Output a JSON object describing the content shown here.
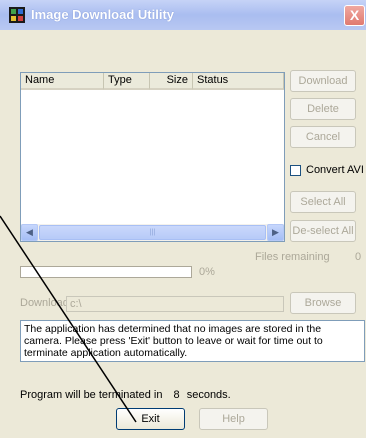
{
  "window": {
    "title": "Image Download Utility",
    "close_glyph": "X"
  },
  "list": {
    "columns": [
      "Name",
      "Type",
      "Size",
      "Status"
    ],
    "rows": [],
    "scroll_thumb_glyph": "|||"
  },
  "buttons": {
    "download": "Download",
    "delete": "Delete",
    "cancel": "Cancel",
    "select_all": "Select All",
    "deselect_all": "De-select All",
    "browse": "Browse",
    "exit": "Exit",
    "help": "Help"
  },
  "convert_avi": {
    "label": "Convert AVI",
    "checked": false
  },
  "files_remaining": {
    "label": "Files remaining",
    "value": "0"
  },
  "progress": {
    "value": 0,
    "text": "0%"
  },
  "download_to": {
    "label": "Download to",
    "value": "c:\\"
  },
  "message": "The application has determined that no images are stored in the camera. Please press 'Exit' button to leave or wait for time out to terminate application automatically.",
  "termination": {
    "prefix": "Program will be terminated in",
    "seconds": "8",
    "unit": "seconds."
  }
}
